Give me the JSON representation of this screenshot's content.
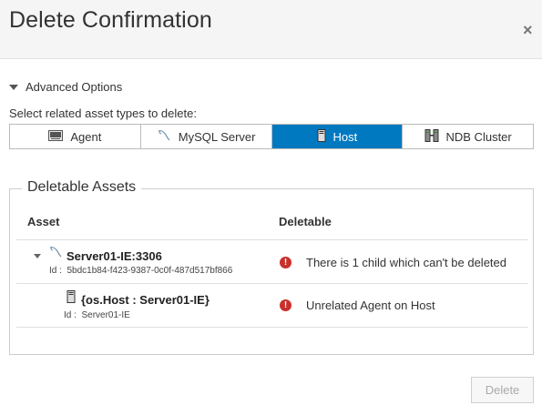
{
  "dialog": {
    "title": "Delete Confirmation",
    "close_symbol": "×"
  },
  "advanced": {
    "label": "Advanced Options",
    "select_label": "Select related asset types to delete:"
  },
  "asset_types": [
    {
      "label": "Agent",
      "icon": "agent-icon",
      "selected": false
    },
    {
      "label": "MySQL Server",
      "icon": "mysql-dolphin-icon",
      "selected": false
    },
    {
      "label": "Host",
      "icon": "host-server-icon",
      "selected": true
    },
    {
      "label": "NDB Cluster",
      "icon": "ndb-cluster-icon",
      "selected": false
    }
  ],
  "deletable": {
    "legend": "Deletable Assets",
    "headers": {
      "asset": "Asset",
      "deletable": "Deletable"
    },
    "rows": [
      {
        "name": "Server01-IE:3306",
        "id_label": "Id :",
        "id": "5bdc1b84-f423-9387-0c0f-487d517bf866",
        "status": "There is 1 child which can't be deleted",
        "icon": "mysql-dolphin-icon"
      },
      {
        "name": "{os.Host : Server01-IE}",
        "id_label": "Id :",
        "id": "Server01-IE",
        "status": "Unrelated Agent on Host",
        "icon": "host-server-icon"
      }
    ]
  },
  "footer": {
    "delete_label": "Delete"
  },
  "colors": {
    "accent": "#0079c1",
    "error": "#c9302c"
  }
}
